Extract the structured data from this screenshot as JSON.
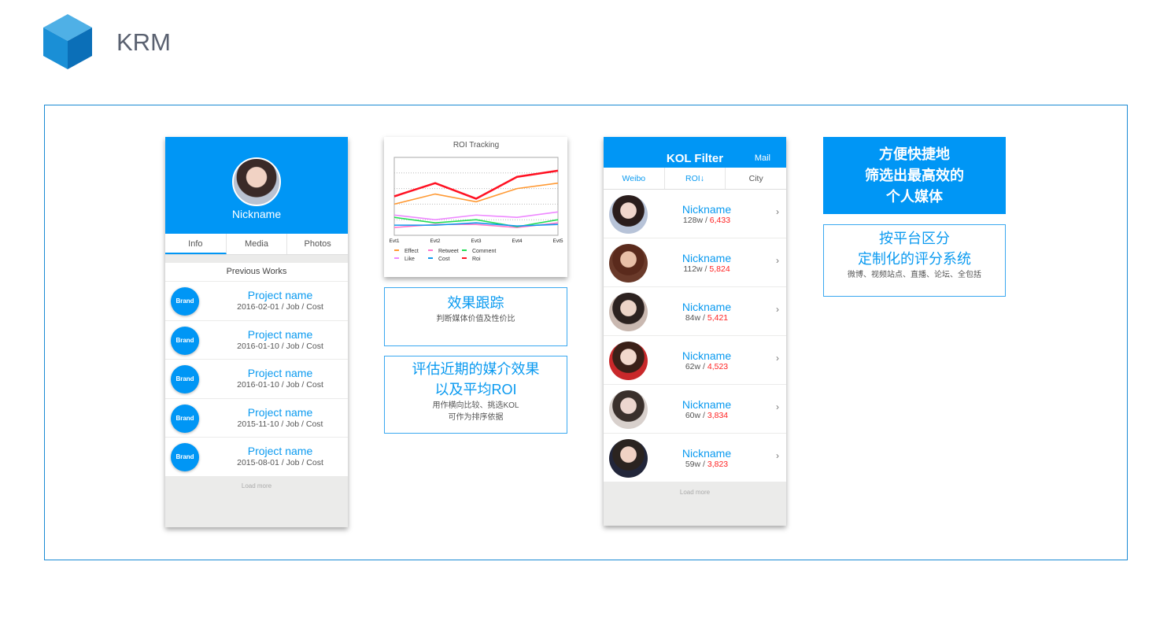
{
  "header": {
    "title": "KRM"
  },
  "profile": {
    "nickname": "Nickname",
    "tabs": [
      "Info",
      "Media",
      "Photos"
    ],
    "section": "Previous Works",
    "works": [
      {
        "badge": "Brand",
        "title": "Project name",
        "meta": "2016-02-01 / Job / Cost"
      },
      {
        "badge": "Brand",
        "title": "Project name",
        "meta": "2016-01-10 / Job / Cost"
      },
      {
        "badge": "Brand",
        "title": "Project name",
        "meta": "2016-01-10 / Job / Cost"
      },
      {
        "badge": "Brand",
        "title": "Project name",
        "meta": "2015-11-10 / Job / Cost"
      },
      {
        "badge": "Brand",
        "title": "Project name",
        "meta": "2015-08-01 / Job / Cost"
      }
    ],
    "load_more": "Load more"
  },
  "chart_data": {
    "type": "line",
    "title": "ROI Tracking",
    "categories": [
      "Evt1",
      "Evt2",
      "Evt3",
      "Evt4",
      "Evt5"
    ],
    "ylim": [
      0,
      100
    ],
    "grid": true,
    "legend": "bottom",
    "series": [
      {
        "name": "Effect",
        "color": "#ff9933",
        "values": [
          40,
          53,
          43,
          60,
          67
        ]
      },
      {
        "name": "Retweet",
        "color": "#ff77cc",
        "values": [
          10,
          14,
          14,
          10,
          16
        ]
      },
      {
        "name": "Comment",
        "color": "#22dd55",
        "values": [
          23,
          16,
          20,
          11,
          20
        ]
      },
      {
        "name": "Like",
        "color": "#ee88ff",
        "values": [
          26,
          20,
          26,
          23,
          30
        ]
      },
      {
        "name": "Cost",
        "color": "#1199ee",
        "values": [
          13,
          13,
          16,
          12,
          14
        ]
      },
      {
        "name": "Roi",
        "color": "#ff1122",
        "values": [
          50,
          67,
          47,
          75,
          83
        ]
      }
    ]
  },
  "box1": {
    "title": "效果跟踪",
    "sub": "判断媒体价值及性价比"
  },
  "box2": {
    "title1": "评估近期的媒介效果",
    "title2": "以及平均ROI",
    "sub1": "用作横向比较、挑选KOL",
    "sub2": "可作为排序依据"
  },
  "kol": {
    "title": "KOL Filter",
    "mail": "Mail",
    "tabs": [
      "Weibo",
      "ROI↓",
      "City"
    ],
    "items": [
      {
        "name": "Nickname",
        "fans": "128w / ",
        "score": "6,433"
      },
      {
        "name": "Nickname",
        "fans": "112w / ",
        "score": "5,824"
      },
      {
        "name": "Nickname",
        "fans": "84w / ",
        "score": "5,421"
      },
      {
        "name": "Nickname",
        "fans": "62w / ",
        "score": "4,523"
      },
      {
        "name": "Nickname",
        "fans": "60w / ",
        "score": "3,834"
      },
      {
        "name": "Nickname",
        "fans": "59w / ",
        "score": "3,823"
      }
    ],
    "chevron": "›",
    "load_more": "Load more"
  },
  "right1": {
    "lines": [
      "方便快捷地",
      "筛选出最高效的",
      "个人媒体"
    ]
  },
  "right2": {
    "title1": "按平台区分",
    "title2": "定制化的评分系统",
    "sub": "微博、视频站点、直播、论坛、全包括"
  },
  "colors": {
    "accent": "#0096f5",
    "score": "#ff2222"
  }
}
